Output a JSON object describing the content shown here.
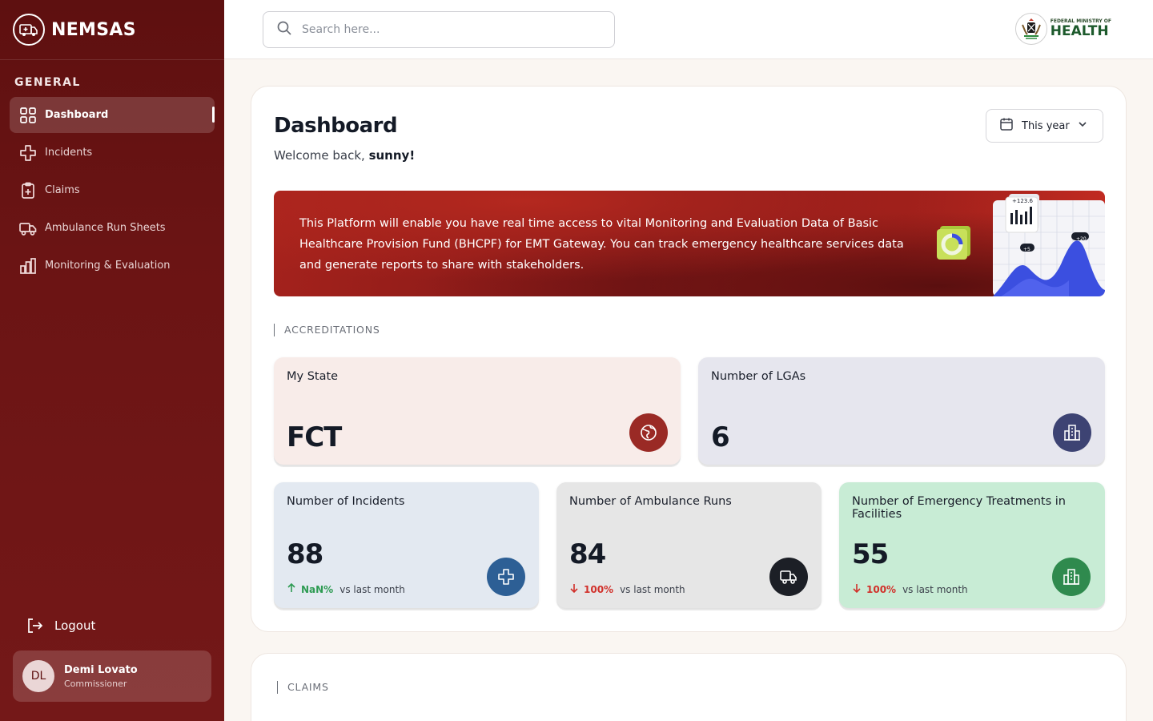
{
  "brand": {
    "name": "NEMSAS",
    "logo_icon": "ambulance-logo-icon"
  },
  "sidebar": {
    "section_title": "GENERAL",
    "items": [
      {
        "label": "Dashboard",
        "icon": "grid-icon",
        "active": true
      },
      {
        "label": "Incidents",
        "icon": "medical-cross-icon"
      },
      {
        "label": "Claims",
        "icon": "clipboard-plus-icon"
      },
      {
        "label": "Ambulance Run Sheets",
        "icon": "ambulance-icon"
      },
      {
        "label": "Monitoring & Evaluation",
        "icon": "bar-chart-icon"
      }
    ],
    "logout_label": "Logout",
    "user": {
      "initials": "DL",
      "name": "Demi Lovato",
      "role": "Commissioner"
    }
  },
  "topbar": {
    "search_placeholder": "Search here...",
    "ministry": {
      "small": "FEDERAL MINISTRY OF",
      "big": "HEALTH"
    }
  },
  "main": {
    "title": "Dashboard",
    "welcome_prefix": "Welcome back, ",
    "welcome_name": "sunny!",
    "period": "This year",
    "banner_text": "This Platform will enable you have real time access to vital Monitoring and Evaluation Data of Basic Healthcare Provision Fund (BHCPF) for EMT Gateway. You can track emergency healthcare services data and generate reports to share with stakeholders.",
    "banner_art": {
      "tag1": "+123.6",
      "tag2": "+5",
      "tag3": "+20"
    },
    "accreditations_label": "ACCREDITATIONS",
    "cards_top": [
      {
        "title": "My State",
        "value": "FCT",
        "icon": "globe-icon",
        "bg": "#f8ece9",
        "icon_bg": "#9a2a25"
      },
      {
        "title": "Number of LGAs",
        "value": "6",
        "icon": "building-icon",
        "bg": "#e6e6ee",
        "icon_bg": "#3d4373"
      }
    ],
    "cards_bottom": [
      {
        "title": "Number of Incidents",
        "value": "88",
        "trend": "up",
        "pct": "NaN%",
        "suffix": "vs last month",
        "icon": "medical-cross-icon",
        "bg": "#e3e9f1",
        "icon_bg": "#2d5f95"
      },
      {
        "title": "Number of Ambulance Runs",
        "value": "84",
        "trend": "down",
        "pct": "100%",
        "suffix": "vs last month",
        "icon": "truck-icon",
        "bg": "#e6e6e6",
        "icon_bg": "#1c1f26"
      },
      {
        "title": "Number of Emergency Treatments in Facilities",
        "value": "55",
        "trend": "down",
        "pct": "100%",
        "suffix": "vs last month",
        "icon": "building-icon",
        "bg": "#c8ecd5",
        "icon_bg": "#2f8a4e"
      }
    ],
    "claims_label": "CLAIMS"
  },
  "colors": {
    "sidebar": "#6b1414",
    "accent_red": "#a5221c",
    "up": "#2e9b53",
    "down": "#d1302a"
  }
}
